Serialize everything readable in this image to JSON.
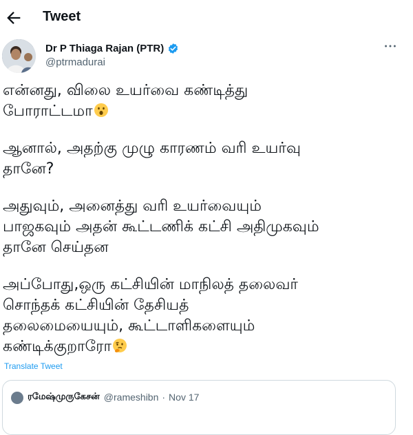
{
  "header": {
    "title": "Tweet"
  },
  "author": {
    "name": "Dr P Thiaga Rajan (PTR)",
    "handle": "@ptrmadurai"
  },
  "tweet": {
    "lines": [
      "என்னது, விலை உயர்வை கண்டித்து",
      "போராட்டமா",
      "ஆனால், அதற்கு முழு காரணம் வரி உயர்வு",
      "தானே?",
      "அதுவும், அனைத்து வரி உயர்வையும்",
      "பாஜகவும் அதன் கூட்டணிக் கட்சி அதிமுகவும்",
      "தானே செய்தன",
      "அப்போது,ஒரு கட்சியின் மாநிலத் தலைவர்",
      "சொந்தக் கட்சியின் தேசியத்",
      "தலைமையையும், கூட்டாளிகளையும்",
      "கண்டிக்குறாரோ"
    ],
    "emojis": [
      "surprised-face-emoji",
      "thinking-face-emoji"
    ]
  },
  "translate_label": "Translate Tweet",
  "quoted": {
    "name": "ரமேஷ்முருகேசன்",
    "handle": "@rameshibn",
    "separator": "·",
    "date": "Nov 17"
  }
}
